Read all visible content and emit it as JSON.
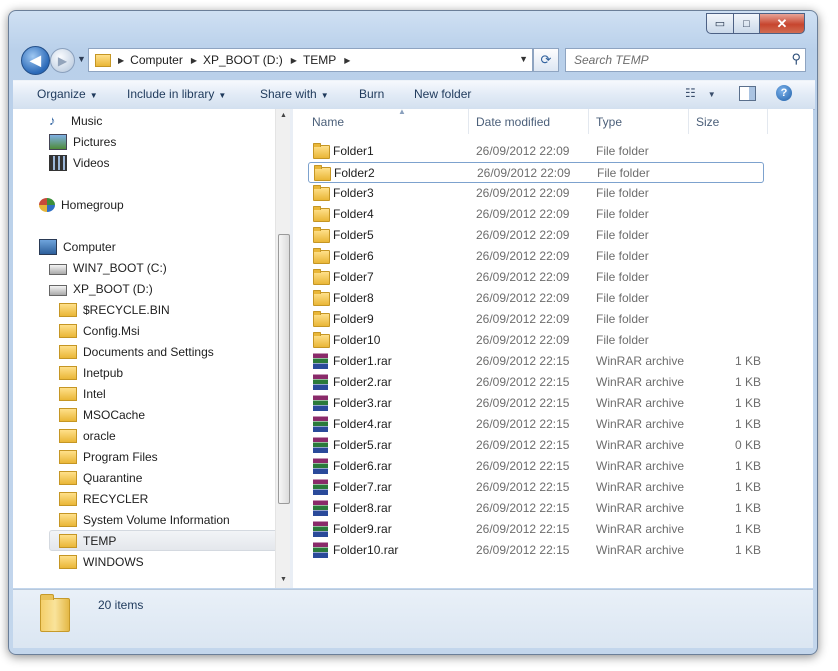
{
  "window": {
    "controls": {
      "minimize": "▭",
      "maximize": "□",
      "close": "✕"
    }
  },
  "nav": {
    "back_glyph": "◀",
    "forward_glyph": "▶",
    "breadcrumbs": [
      "Computer",
      "XP_BOOT (D:)",
      "TEMP"
    ],
    "refresh_glyph": "⟳"
  },
  "search": {
    "placeholder": "Search TEMP"
  },
  "toolbar": {
    "organize": "Organize",
    "include": "Include in library",
    "share": "Share with",
    "burn": "Burn",
    "new_folder": "New folder"
  },
  "sidebar": {
    "items": [
      {
        "label": "Music",
        "icon": "music-icon"
      },
      {
        "label": "Pictures",
        "icon": "pictures-icon"
      },
      {
        "label": "Videos",
        "icon": "videos-icon"
      },
      {
        "label": "Homegroup",
        "icon": "homegroup-icon"
      },
      {
        "label": "Computer",
        "icon": "computer-icon"
      },
      {
        "label": "WIN7_BOOT (C:)",
        "icon": "drive-icon"
      },
      {
        "label": "XP_BOOT (D:)",
        "icon": "drive-icon"
      },
      {
        "label": "$RECYCLE.BIN",
        "icon": "folder-icon"
      },
      {
        "label": "Config.Msi",
        "icon": "folder-icon"
      },
      {
        "label": "Documents and Settings",
        "icon": "folder-icon"
      },
      {
        "label": "Inetpub",
        "icon": "folder-icon"
      },
      {
        "label": "Intel",
        "icon": "folder-icon"
      },
      {
        "label": "MSOCache",
        "icon": "folder-icon"
      },
      {
        "label": "oracle",
        "icon": "folder-icon"
      },
      {
        "label": "Program Files",
        "icon": "folder-icon"
      },
      {
        "label": "Quarantine",
        "icon": "folder-icon"
      },
      {
        "label": "RECYCLER",
        "icon": "folder-icon"
      },
      {
        "label": "System Volume Information",
        "icon": "folder-icon"
      },
      {
        "label": "TEMP",
        "icon": "folder-icon",
        "selected": true
      },
      {
        "label": "WINDOWS",
        "icon": "folder-icon"
      }
    ]
  },
  "columns": {
    "name": "Name",
    "date": "Date modified",
    "type": "Type",
    "size": "Size"
  },
  "files": [
    {
      "name": "Folder1",
      "date": "26/09/2012 22:09",
      "type": "File folder",
      "size": ""
    },
    {
      "name": "Folder2",
      "date": "26/09/2012 22:09",
      "type": "File folder",
      "size": "",
      "focused": true
    },
    {
      "name": "Folder3",
      "date": "26/09/2012 22:09",
      "type": "File folder",
      "size": ""
    },
    {
      "name": "Folder4",
      "date": "26/09/2012 22:09",
      "type": "File folder",
      "size": ""
    },
    {
      "name": "Folder5",
      "date": "26/09/2012 22:09",
      "type": "File folder",
      "size": ""
    },
    {
      "name": "Folder6",
      "date": "26/09/2012 22:09",
      "type": "File folder",
      "size": ""
    },
    {
      "name": "Folder7",
      "date": "26/09/2012 22:09",
      "type": "File folder",
      "size": ""
    },
    {
      "name": "Folder8",
      "date": "26/09/2012 22:09",
      "type": "File folder",
      "size": ""
    },
    {
      "name": "Folder9",
      "date": "26/09/2012 22:09",
      "type": "File folder",
      "size": ""
    },
    {
      "name": "Folder10",
      "date": "26/09/2012 22:09",
      "type": "File folder",
      "size": ""
    },
    {
      "name": "Folder1.rar",
      "date": "26/09/2012 22:15",
      "type": "WinRAR archive",
      "size": "1 KB"
    },
    {
      "name": "Folder2.rar",
      "date": "26/09/2012 22:15",
      "type": "WinRAR archive",
      "size": "1 KB"
    },
    {
      "name": "Folder3.rar",
      "date": "26/09/2012 22:15",
      "type": "WinRAR archive",
      "size": "1 KB"
    },
    {
      "name": "Folder4.rar",
      "date": "26/09/2012 22:15",
      "type": "WinRAR archive",
      "size": "1 KB"
    },
    {
      "name": "Folder5.rar",
      "date": "26/09/2012 22:15",
      "type": "WinRAR archive",
      "size": "0 KB"
    },
    {
      "name": "Folder6.rar",
      "date": "26/09/2012 22:15",
      "type": "WinRAR archive",
      "size": "1 KB"
    },
    {
      "name": "Folder7.rar",
      "date": "26/09/2012 22:15",
      "type": "WinRAR archive",
      "size": "1 KB"
    },
    {
      "name": "Folder8.rar",
      "date": "26/09/2012 22:15",
      "type": "WinRAR archive",
      "size": "1 KB"
    },
    {
      "name": "Folder9.rar",
      "date": "26/09/2012 22:15",
      "type": "WinRAR archive",
      "size": "1 KB"
    },
    {
      "name": "Folder10.rar",
      "date": "26/09/2012 22:15",
      "type": "WinRAR archive",
      "size": "1 KB"
    }
  ],
  "details": {
    "count": "20 items"
  },
  "colors": {
    "accent": "#1e395b",
    "frame": "#b9d0ea",
    "folder": "#e9b637",
    "selection_border": "#7da2ce"
  }
}
